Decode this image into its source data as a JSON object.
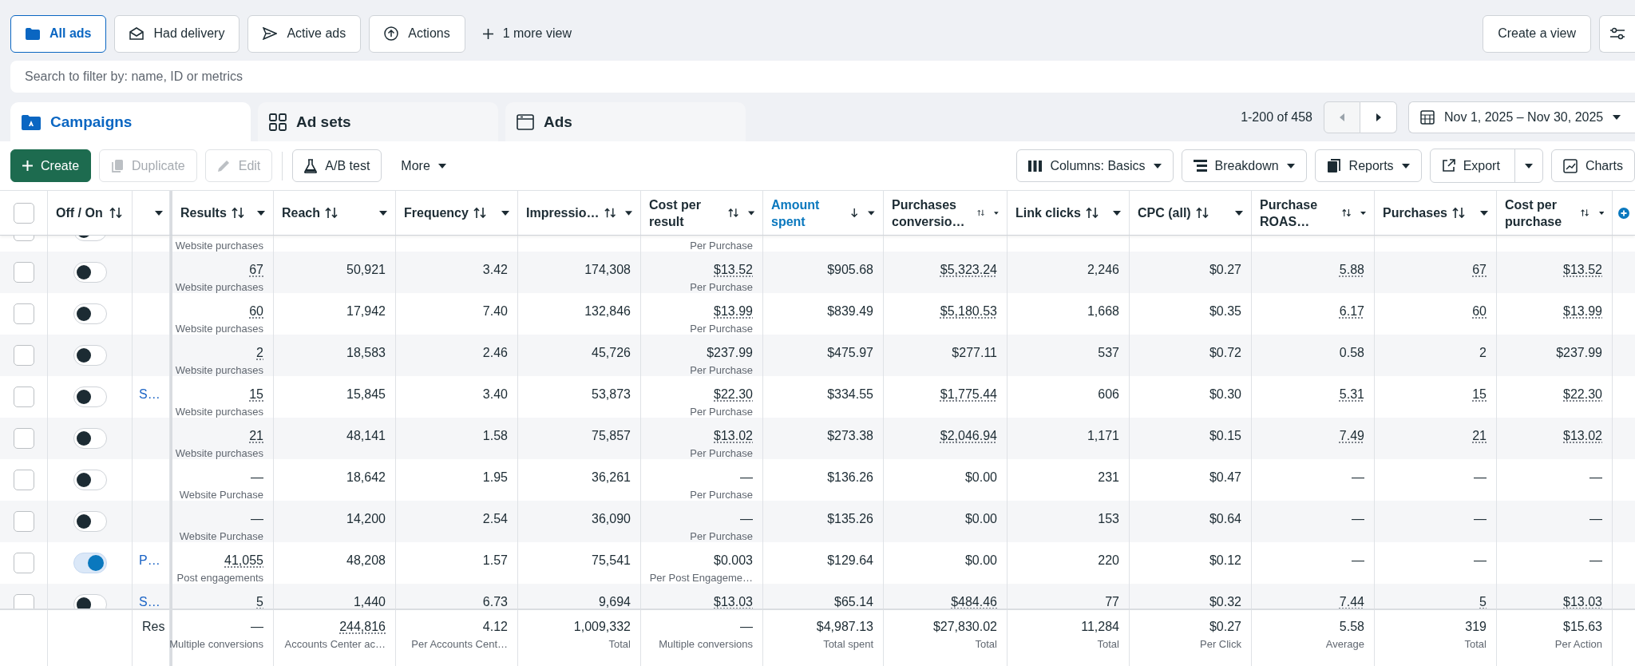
{
  "views": [
    {
      "label": "All ads",
      "selected": true
    },
    {
      "label": "Had delivery",
      "selected": false
    },
    {
      "label": "Active ads",
      "selected": false
    },
    {
      "label": "Actions",
      "selected": false
    }
  ],
  "more_views": "1 more view",
  "create_view": "Create a view",
  "search": {
    "placeholder": "Search to filter by: name, ID or metrics"
  },
  "tabs": [
    {
      "label": "Campaigns",
      "selected": true
    },
    {
      "label": "Ad sets",
      "selected": false
    },
    {
      "label": "Ads",
      "selected": false
    }
  ],
  "pagination": {
    "range": "1-200 of 458",
    "previous_disabled": true
  },
  "date_range": "Nov 1, 2025 – Nov 30, 2025",
  "toolbar": [
    {
      "label": "Create",
      "kind": "primary",
      "disabled": false
    },
    {
      "label": "Duplicate",
      "kind": "duplicate",
      "disabled": true
    },
    {
      "label": "Edit",
      "kind": "edit",
      "disabled": true
    },
    {
      "label": "A/B test",
      "kind": "abtest",
      "disabled": false
    },
    {
      "label": "More",
      "kind": "menu",
      "disabled": false
    }
  ],
  "toolbar_right": [
    {
      "label": "Columns: Basics",
      "kind": "columns"
    },
    {
      "label": "Breakdown",
      "kind": "breakdown"
    },
    {
      "label": "Reports",
      "kind": "reports"
    },
    {
      "label": "Export",
      "kind": "export"
    },
    {
      "label": "Charts",
      "kind": "charts"
    }
  ],
  "select_all": {
    "checked": false
  },
  "toggle_column": "Off / On",
  "columns": [
    {
      "label": "Results",
      "sorted": false
    },
    {
      "label": "Reach",
      "sorted": false
    },
    {
      "label": "Frequency",
      "sorted": false
    },
    {
      "label": "Impressio…",
      "sorted": false
    },
    {
      "label": "Cost per result",
      "sorted": false
    },
    {
      "label": "Amount spent",
      "sorted": true
    },
    {
      "label": "Purchases conversio…",
      "sorted": false
    },
    {
      "label": "Link clicks",
      "sorted": false
    },
    {
      "label": "CPC (all)",
      "sorted": false
    },
    {
      "label": "Purchase ROAS…",
      "sorted": false
    },
    {
      "label": "Purchases",
      "sorted": false
    },
    {
      "label": "Cost per purchase",
      "sorted": false
    }
  ],
  "partial_row": {
    "selected": false,
    "on": false,
    "results_note": "Website purchases",
    "cost_note": "Per Purchase"
  },
  "rows": [
    {
      "selected": false,
      "on": false,
      "cells": [
        {
          "text": "67",
          "underlined": true,
          "note": "Website purchases"
        },
        {
          "text": "50,921",
          "underlined": false
        },
        {
          "text": "3.42",
          "underlined": false
        },
        {
          "text": "174,308",
          "underlined": false
        },
        {
          "text": "$13.52",
          "underlined": true,
          "note": "Per Purchase"
        },
        {
          "text": "$905.68",
          "underlined": false
        },
        {
          "text": "$5,323.24",
          "underlined": true
        },
        {
          "text": "2,246",
          "underlined": false
        },
        {
          "text": "$0.27",
          "underlined": false
        },
        {
          "text": "5.88",
          "underlined": true
        },
        {
          "text": "67",
          "underlined": true
        },
        {
          "text": "$13.52",
          "underlined": true
        }
      ]
    },
    {
      "selected": false,
      "on": false,
      "cells": [
        {
          "text": "60",
          "underlined": true,
          "note": "Website purchases"
        },
        {
          "text": "17,942",
          "underlined": false
        },
        {
          "text": "7.40",
          "underlined": false
        },
        {
          "text": "132,846",
          "underlined": false
        },
        {
          "text": "$13.99",
          "underlined": true,
          "note": "Per Purchase"
        },
        {
          "text": "$839.49",
          "underlined": false
        },
        {
          "text": "$5,180.53",
          "underlined": true
        },
        {
          "text": "1,668",
          "underlined": false
        },
        {
          "text": "$0.35",
          "underlined": false
        },
        {
          "text": "6.17",
          "underlined": true
        },
        {
          "text": "60",
          "underlined": true
        },
        {
          "text": "$13.99",
          "underlined": true
        }
      ]
    },
    {
      "selected": false,
      "on": false,
      "cells": [
        {
          "text": "2",
          "underlined": true,
          "note": "Website purchases"
        },
        {
          "text": "18,583",
          "underlined": false
        },
        {
          "text": "2.46",
          "underlined": false
        },
        {
          "text": "45,726",
          "underlined": false
        },
        {
          "text": "$237.99",
          "underlined": false,
          "note": "Per Purchase"
        },
        {
          "text": "$475.97",
          "underlined": false
        },
        {
          "text": "$277.11",
          "underlined": false
        },
        {
          "text": "537",
          "underlined": false
        },
        {
          "text": "$0.72",
          "underlined": false
        },
        {
          "text": "0.58",
          "underlined": false
        },
        {
          "text": "2",
          "underlined": false
        },
        {
          "text": "$237.99",
          "underlined": false
        }
      ]
    },
    {
      "selected": false,
      "on": false,
      "name": "S…",
      "cells": [
        {
          "text": "15",
          "underlined": true,
          "note": "Website purchases"
        },
        {
          "text": "15,845",
          "underlined": false
        },
        {
          "text": "3.40",
          "underlined": false
        },
        {
          "text": "53,873",
          "underlined": false
        },
        {
          "text": "$22.30",
          "underlined": true,
          "note": "Per Purchase"
        },
        {
          "text": "$334.55",
          "underlined": false
        },
        {
          "text": "$1,775.44",
          "underlined": true
        },
        {
          "text": "606",
          "underlined": false
        },
        {
          "text": "$0.30",
          "underlined": false
        },
        {
          "text": "5.31",
          "underlined": true
        },
        {
          "text": "15",
          "underlined": true
        },
        {
          "text": "$22.30",
          "underlined": true
        }
      ]
    },
    {
      "selected": false,
      "on": false,
      "cells": [
        {
          "text": "21",
          "underlined": true,
          "note": "Website purchases"
        },
        {
          "text": "48,141",
          "underlined": false
        },
        {
          "text": "1.58",
          "underlined": false
        },
        {
          "text": "75,857",
          "underlined": false
        },
        {
          "text": "$13.02",
          "underlined": true,
          "note": "Per Purchase"
        },
        {
          "text": "$273.38",
          "underlined": false
        },
        {
          "text": "$2,046.94",
          "underlined": true
        },
        {
          "text": "1,171",
          "underlined": false
        },
        {
          "text": "$0.15",
          "underlined": false
        },
        {
          "text": "7.49",
          "underlined": true
        },
        {
          "text": "21",
          "underlined": true
        },
        {
          "text": "$13.02",
          "underlined": true
        }
      ]
    },
    {
      "selected": false,
      "on": false,
      "cells": [
        {
          "text": "—",
          "underlined": false,
          "note": "Website Purchase"
        },
        {
          "text": "18,642",
          "underlined": false
        },
        {
          "text": "1.95",
          "underlined": false
        },
        {
          "text": "36,261",
          "underlined": false
        },
        {
          "text": "—",
          "underlined": false,
          "note": "Per Purchase"
        },
        {
          "text": "$136.26",
          "underlined": false
        },
        {
          "text": "$0.00",
          "underlined": false
        },
        {
          "text": "231",
          "underlined": false
        },
        {
          "text": "$0.47",
          "underlined": false
        },
        {
          "text": "—",
          "underlined": false
        },
        {
          "text": "—",
          "underlined": false
        },
        {
          "text": "—",
          "underlined": false
        }
      ]
    },
    {
      "selected": false,
      "on": false,
      "cells": [
        {
          "text": "—",
          "underlined": false,
          "note": "Website Purchase"
        },
        {
          "text": "14,200",
          "underlined": false
        },
        {
          "text": "2.54",
          "underlined": false
        },
        {
          "text": "36,090",
          "underlined": false
        },
        {
          "text": "—",
          "underlined": false,
          "note": "Per Purchase"
        },
        {
          "text": "$135.26",
          "underlined": false
        },
        {
          "text": "$0.00",
          "underlined": false
        },
        {
          "text": "153",
          "underlined": false
        },
        {
          "text": "$0.64",
          "underlined": false
        },
        {
          "text": "—",
          "underlined": false
        },
        {
          "text": "—",
          "underlined": false
        },
        {
          "text": "—",
          "underlined": false
        }
      ]
    },
    {
      "selected": false,
      "on": true,
      "name": "P…",
      "cells": [
        {
          "text": "41,055",
          "underlined": true,
          "note": "Post engagements"
        },
        {
          "text": "48,208",
          "underlined": false
        },
        {
          "text": "1.57",
          "underlined": false
        },
        {
          "text": "75,541",
          "underlined": false
        },
        {
          "text": "$0.003",
          "underlined": false,
          "note": "Per Post Engageme…"
        },
        {
          "text": "$129.64",
          "underlined": false
        },
        {
          "text": "$0.00",
          "underlined": false
        },
        {
          "text": "220",
          "underlined": false
        },
        {
          "text": "$0.12",
          "underlined": false
        },
        {
          "text": "—",
          "underlined": false
        },
        {
          "text": "—",
          "underlined": false
        },
        {
          "text": "—",
          "underlined": false
        }
      ]
    },
    {
      "selected": false,
      "on": false,
      "name": "S…",
      "cells": [
        {
          "text": "5",
          "underlined": true
        },
        {
          "text": "1,440",
          "underlined": false
        },
        {
          "text": "6.73",
          "underlined": false
        },
        {
          "text": "9,694",
          "underlined": false
        },
        {
          "text": "$13.03",
          "underlined": true
        },
        {
          "text": "$65.14",
          "underlined": false
        },
        {
          "text": "$484.46",
          "underlined": true
        },
        {
          "text": "77",
          "underlined": false
        },
        {
          "text": "$0.32",
          "underlined": false
        },
        {
          "text": "7.44",
          "underlined": true
        },
        {
          "text": "5",
          "underlined": true
        },
        {
          "text": "$13.03",
          "underlined": true
        }
      ]
    }
  ],
  "totals": {
    "label": "Res",
    "cells": [
      {
        "text": "—",
        "underlined": false,
        "note": "Multiple conversions"
      },
      {
        "text": "244,816",
        "underlined": true,
        "note": "Accounts Center ac…"
      },
      {
        "text": "4.12",
        "underlined": false,
        "note": "Per Accounts Cent…"
      },
      {
        "text": "1,009,332",
        "underlined": false,
        "note": "Total"
      },
      {
        "text": "—",
        "underlined": false,
        "note": "Multiple conversions"
      },
      {
        "text": "$4,987.13",
        "underlined": false,
        "note": "Total spent"
      },
      {
        "text": "$27,830.02",
        "underlined": false,
        "note": "Total"
      },
      {
        "text": "11,284",
        "underlined": false,
        "note": "Total"
      },
      {
        "text": "$0.27",
        "underlined": false,
        "note": "Per Click"
      },
      {
        "text": "5.58",
        "underlined": false,
        "note": "Average"
      },
      {
        "text": "319",
        "underlined": false,
        "note": "Total"
      },
      {
        "text": "$15.63",
        "underlined": false,
        "note": "Per Action"
      }
    ]
  }
}
